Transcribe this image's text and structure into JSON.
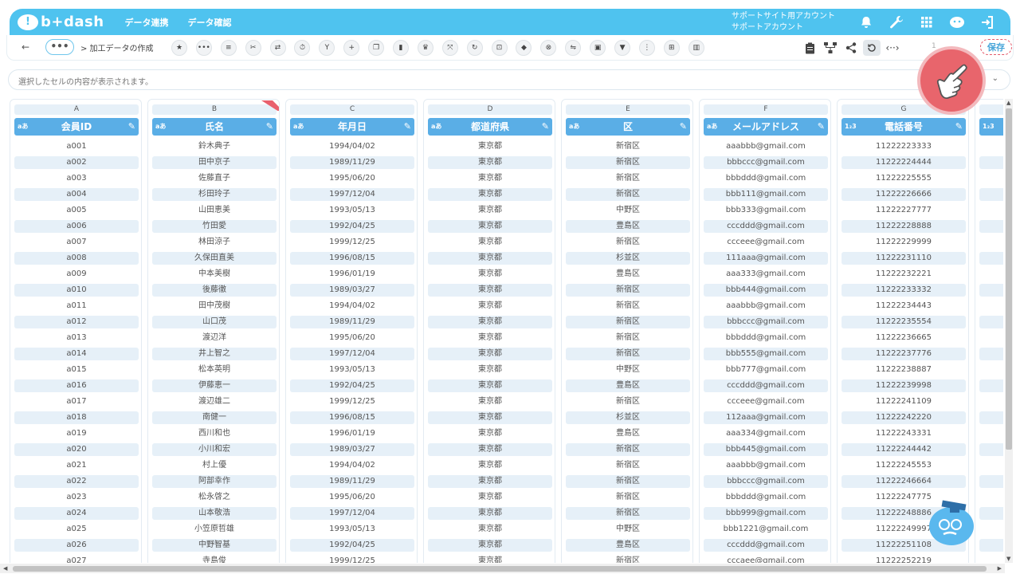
{
  "header": {
    "logo_text": "b+dash",
    "nav": [
      "データ連携",
      "データ確認"
    ],
    "account_line1": "サポートサイト用アカウント",
    "account_line2": "サポートアカウント"
  },
  "toolbar": {
    "back_label": "←",
    "more_label": "•••",
    "breadcrumb": "> 加工データの作成",
    "save_label": "保存",
    "toggle_text": "1"
  },
  "cellbar": {
    "placeholder": "選択したセルの内容が表示されます。",
    "chevron": "⌄"
  },
  "columns": [
    {
      "letter": "A",
      "name": "会員ID",
      "type": "aあ",
      "new": false,
      "values": [
        "a001",
        "a002",
        "a003",
        "a004",
        "a005",
        "a006",
        "a007",
        "a008",
        "a009",
        "a010",
        "a011",
        "a012",
        "a013",
        "a014",
        "a015",
        "a016",
        "a017",
        "a018",
        "a019",
        "a020",
        "a021",
        "a022",
        "a023",
        "a024",
        "a025",
        "a026",
        "a027"
      ]
    },
    {
      "letter": "B",
      "name": "氏名",
      "type": "aあ",
      "new": true,
      "values": [
        "鈴木典子",
        "田中京子",
        "佐藤直子",
        "杉田玲子",
        "山田恵美",
        "竹田愛",
        "林田涼子",
        "久保田直美",
        "中本美樹",
        "後藤徹",
        "田中茂樹",
        "山口茂",
        "渡辺洋",
        "井上智之",
        "松本英明",
        "伊藤恵一",
        "渡辺雄二",
        "南健一",
        "西川和也",
        "小川和宏",
        "村上優",
        "阿部幸作",
        "松永啓之",
        "山本敬浩",
        "小笠原哲雄",
        "中野智基",
        "寺島俊"
      ]
    },
    {
      "letter": "C",
      "name": "年月日",
      "type": "aあ",
      "new": false,
      "values": [
        "1994/04/02",
        "1989/11/29",
        "1995/06/20",
        "1997/12/04",
        "1993/05/13",
        "1992/04/25",
        "1999/12/25",
        "1996/08/15",
        "1996/01/19",
        "1989/03/27",
        "1994/04/02",
        "1989/11/29",
        "1995/06/20",
        "1997/12/04",
        "1993/05/13",
        "1992/04/25",
        "1999/12/25",
        "1996/08/15",
        "1996/01/19",
        "1989/03/27",
        "1994/04/02",
        "1989/11/29",
        "1995/06/20",
        "1997/12/04",
        "1993/05/13",
        "1992/04/25",
        "1999/12/25"
      ]
    },
    {
      "letter": "D",
      "name": "都道府県",
      "type": "aあ",
      "new": false,
      "values": [
        "東京都",
        "東京都",
        "東京都",
        "東京都",
        "東京都",
        "東京都",
        "東京都",
        "東京都",
        "東京都",
        "東京都",
        "東京都",
        "東京都",
        "東京都",
        "東京都",
        "東京都",
        "東京都",
        "東京都",
        "東京都",
        "東京都",
        "東京都",
        "東京都",
        "東京都",
        "東京都",
        "東京都",
        "東京都",
        "東京都",
        "東京都"
      ]
    },
    {
      "letter": "E",
      "name": "区",
      "type": "aあ",
      "new": false,
      "values": [
        "新宿区",
        "新宿区",
        "新宿区",
        "新宿区",
        "中野区",
        "豊島区",
        "新宿区",
        "杉並区",
        "豊島区",
        "新宿区",
        "新宿区",
        "新宿区",
        "新宿区",
        "新宿区",
        "中野区",
        "豊島区",
        "新宿区",
        "杉並区",
        "豊島区",
        "新宿区",
        "新宿区",
        "新宿区",
        "新宿区",
        "新宿区",
        "中野区",
        "豊島区",
        "新宿区"
      ]
    },
    {
      "letter": "F",
      "name": "メールアドレス",
      "type": "aあ",
      "new": false,
      "values": [
        "aaabbb@gmail.com",
        "bbbccc@gmail.com",
        "bbbddd@gmail.com",
        "bbb111@gmail.com",
        "bbb333@gmail.com",
        "cccddd@gmail.com",
        "ccceee@gmail.com",
        "111aaa@gmail.com",
        "aaa333@gmail.com",
        "bbb444@gmail.com",
        "aaabbb@gmail.com",
        "bbbccc@gmail.com",
        "bbbddd@gmail.com",
        "bbb555@gmail.com",
        "bbb777@gmail.com",
        "cccddd@gmail.com",
        "ccceee@gmail.com",
        "112aaa@gmail.com",
        "aaa334@gmail.com",
        "bbb445@gmail.com",
        "aaabbb@gmail.com",
        "bbbccc@gmail.com",
        "bbbddd@gmail.com",
        "bbb999@gmail.com",
        "bbb1221@gmail.com",
        "cccddd@gmail.com",
        "cccaee@gmail.com"
      ]
    },
    {
      "letter": "G",
      "name": "電話番号",
      "type": "1₂3",
      "new": false,
      "values": [
        "11222223333",
        "11222224444",
        "11222225555",
        "11222226666",
        "11222227777",
        "11222228888",
        "11222229999",
        "11222231110",
        "11222232221",
        "11222233332",
        "11222234443",
        "11222235554",
        "11222236665",
        "11222237776",
        "11222238887",
        "11222239998",
        "11222241109",
        "11222242220",
        "11222243331",
        "11222244442",
        "11222245553",
        "11222246664",
        "11222247775",
        "11222248886",
        "11222249997",
        "11222251108",
        "11222252219"
      ]
    },
    {
      "letter": "",
      "name": "",
      "type": "1₂3",
      "new": false,
      "values": [
        "",
        "",
        "",
        "",
        "",
        "",
        "",
        "",
        "",
        "",
        "",
        "",
        "",
        "",
        "",
        "",
        "",
        "",
        "",
        "",
        "",
        "",
        "",
        "",
        "",
        "",
        ""
      ]
    }
  ]
}
